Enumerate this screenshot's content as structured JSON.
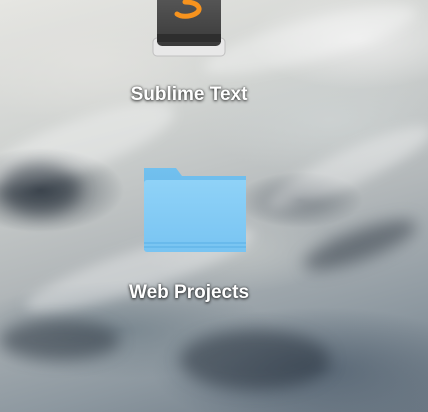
{
  "desktop": {
    "items": [
      {
        "label": "Sublime Text",
        "icon": "sublime-text-app-icon"
      },
      {
        "label": "Web Projects",
        "icon": "folder-icon"
      }
    ]
  },
  "colors": {
    "folder_blue": "#8ccff5",
    "sublime_orange": "#f7931e",
    "label_text": "#ffffff"
  }
}
